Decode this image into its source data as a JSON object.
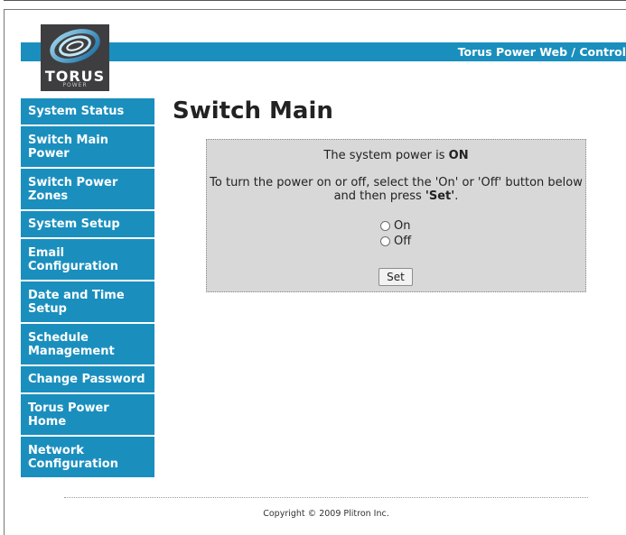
{
  "header": {
    "title": "Torus Power Web / Control"
  },
  "logo": {
    "name": "TORUS",
    "sub": "POWER"
  },
  "sidebar": {
    "items": [
      {
        "label": "System Status"
      },
      {
        "label": "Switch Main Power"
      },
      {
        "label": "Switch Power Zones"
      },
      {
        "label": "System Setup"
      },
      {
        "label": "Email Configuration"
      },
      {
        "label": "Date and Time Setup"
      },
      {
        "label": "Schedule Management"
      },
      {
        "label": "Change Password"
      },
      {
        "label": "Torus Power Home"
      },
      {
        "label": "Network Configuration"
      }
    ]
  },
  "main": {
    "title": "Switch Main",
    "status_prefix": "The system power is ",
    "status_value": "ON",
    "instruction_part1": "To turn the power on or off, select the 'On' or 'Off' button below and then press ",
    "instruction_bold": "'Set'",
    "instruction_end": ".",
    "radio_on": "On",
    "radio_off": "Off",
    "set_label": "Set"
  },
  "footer": {
    "copyright": "Copyright © 2009 Plitron Inc."
  },
  "colors": {
    "accent": "#1a8fbe",
    "panel": "#d8d8d8",
    "logo_bg": "#3e3e40"
  }
}
